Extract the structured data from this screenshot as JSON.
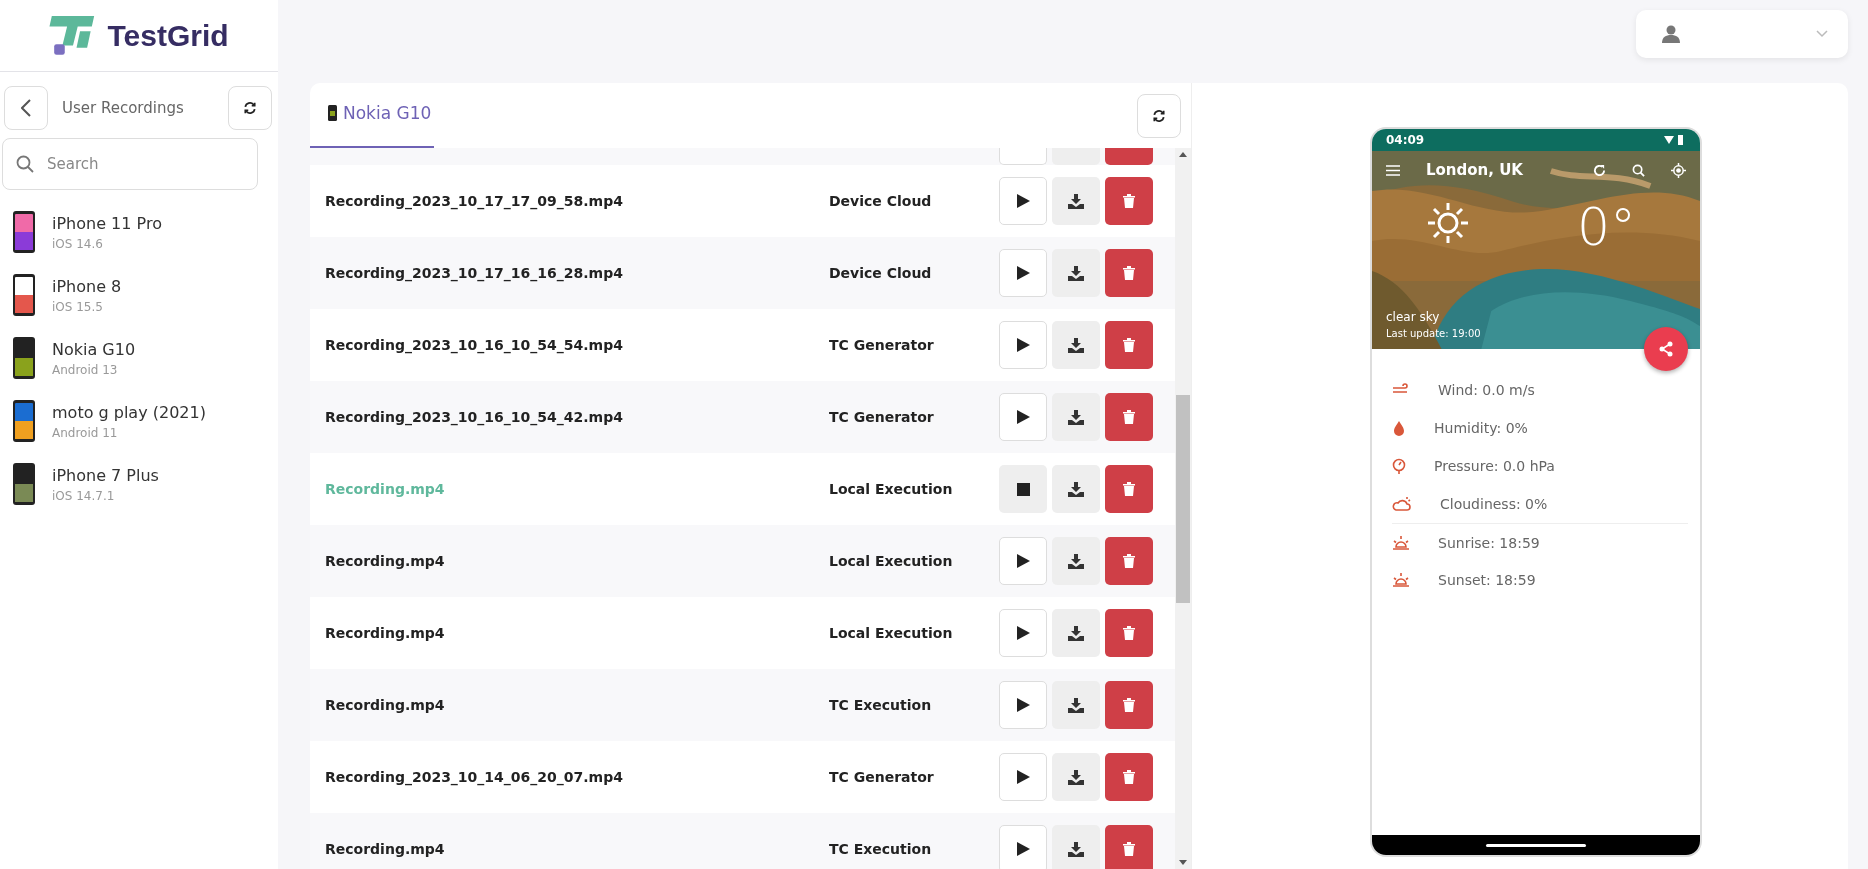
{
  "brand": {
    "name": "TestGrid"
  },
  "sidebar": {
    "title": "User Recordings",
    "search": {
      "placeholder": "Search"
    },
    "devices": [
      {
        "name": "iPhone 11 Pro",
        "os": "iOS 14.6",
        "kind": "pink"
      },
      {
        "name": "iPhone 8",
        "os": "iOS 15.5",
        "kind": "apps"
      },
      {
        "name": "Nokia G10",
        "os": "Android 13",
        "kind": "dark"
      },
      {
        "name": "moto g play (2021)",
        "os": "Android 11",
        "kind": "blue"
      },
      {
        "name": "iPhone 7 Plus",
        "os": "iOS 14.7.1",
        "kind": "green"
      }
    ]
  },
  "tab": {
    "label": "Nokia G10",
    "selected": true
  },
  "recordings": [
    {
      "name": "Recording_2023_10_17_17_09_58.mp4",
      "source": "Device Cloud",
      "playing": false
    },
    {
      "name": "Recording_2023_10_17_16_16_28.mp4",
      "source": "Device Cloud",
      "playing": false
    },
    {
      "name": "Recording_2023_10_16_10_54_54.mp4",
      "source": "TC Generator",
      "playing": false
    },
    {
      "name": "Recording_2023_10_16_10_54_42.mp4",
      "source": "TC Generator",
      "playing": false
    },
    {
      "name": "Recording.mp4",
      "source": "Local Execution",
      "playing": true
    },
    {
      "name": "Recording.mp4",
      "source": "Local Execution",
      "playing": false
    },
    {
      "name": "Recording.mp4",
      "source": "Local Execution",
      "playing": false
    },
    {
      "name": "Recording.mp4",
      "source": "TC Execution",
      "playing": false
    },
    {
      "name": "Recording_2023_10_14_06_20_07.mp4",
      "source": "TC Generator",
      "playing": false
    },
    {
      "name": "Recording.mp4",
      "source": "TC Execution",
      "playing": false
    }
  ],
  "phone": {
    "time": "04:09",
    "city": "London, UK",
    "temperature": "0°",
    "condition": "clear sky",
    "updated": "Last update: 19:00",
    "details": [
      {
        "kind": "wind",
        "text": "Wind: 0.0 m/s"
      },
      {
        "kind": "humidity",
        "text": "Humidity: 0%"
      },
      {
        "kind": "pressure",
        "text": "Pressure: 0.0 hPa"
      },
      {
        "kind": "cloud",
        "text": "Cloudiness: 0%"
      },
      {
        "kind": "sunrise",
        "text": "Sunrise: 18:59"
      },
      {
        "kind": "sunset",
        "text": "Sunset: 18:59"
      }
    ]
  }
}
